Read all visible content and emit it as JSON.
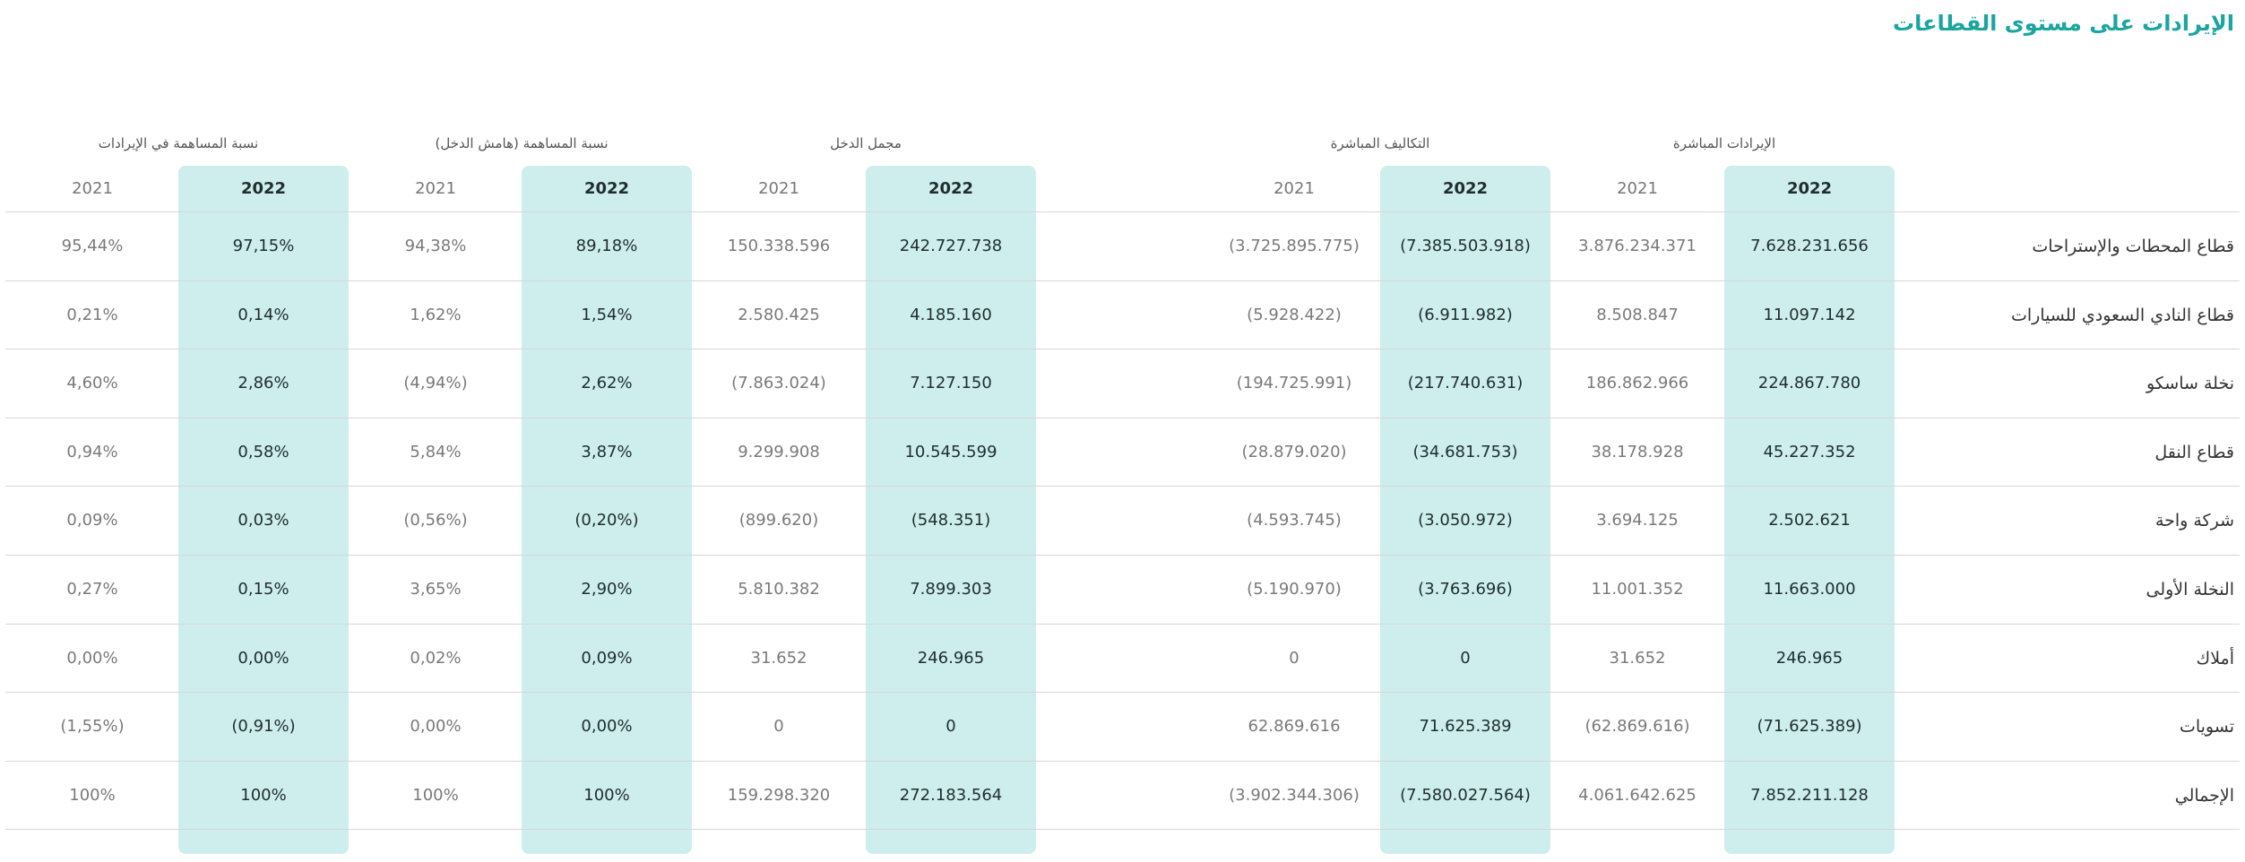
{
  "page_title": "الإيرادات على مستوى القطاعات",
  "group_headers": {
    "direct_revenues": "الإيرادات المباشرة",
    "direct_costs": "التكاليف المباشرة",
    "total_income": "مجمل الدخل",
    "contribution_margin": "نسبة المساهمة (هامش الدخل)",
    "contribution_revenue": "نسبة المساهمة في الإيرادات"
  },
  "years": {
    "current": "2022",
    "previous": "2021"
  },
  "columns": [
    "revenue_2022",
    "revenue_2021",
    "cost_2022",
    "cost_2021",
    "income_2022",
    "income_2021",
    "margin_2022",
    "margin_2021",
    "share_2022",
    "share_2021"
  ],
  "rows": [
    {
      "label": "قطاع المحطات والإستراحات",
      "revenue_2022": "7.628.231.656",
      "revenue_2021": "3.876.234.371",
      "cost_2022": "(7.385.503.918)",
      "cost_2021": "(3.725.895.775)",
      "income_2022": "242.727.738",
      "income_2021": "150.338.596",
      "margin_2022": "89,18%",
      "margin_2021": "94,38%",
      "share_2022": "97,15%",
      "share_2021": "95,44%"
    },
    {
      "label": "قطاع النادي السعودي للسيارات",
      "revenue_2022": "11.097.142",
      "revenue_2021": "8.508.847",
      "cost_2022": "(6.911.982)",
      "cost_2021": "(5.928.422)",
      "income_2022": "4.185.160",
      "income_2021": "2.580.425",
      "margin_2022": "1,54%",
      "margin_2021": "1,62%",
      "share_2022": "0,14%",
      "share_2021": "0,21%"
    },
    {
      "label": "نخلة ساسكو",
      "revenue_2022": "224.867.780",
      "revenue_2021": "186.862.966",
      "cost_2022": "(217.740.631)",
      "cost_2021": "(194.725.991)",
      "income_2022": "7.127.150",
      "income_2021": "(7.863.024)",
      "margin_2022": "2,62%",
      "margin_2021": "(4,94%)",
      "share_2022": "2,86%",
      "share_2021": "4,60%"
    },
    {
      "label": "قطاع النقل",
      "revenue_2022": "45.227.352",
      "revenue_2021": "38.178.928",
      "cost_2022": "(34.681.753)",
      "cost_2021": "(28.879.020)",
      "income_2022": "10.545.599",
      "income_2021": "9.299.908",
      "margin_2022": "3,87%",
      "margin_2021": "5,84%",
      "share_2022": "0,58%",
      "share_2021": "0,94%"
    },
    {
      "label": "شركة واحة",
      "revenue_2022": "2.502.621",
      "revenue_2021": "3.694.125",
      "cost_2022": "(3.050.972)",
      "cost_2021": "(4.593.745)",
      "income_2022": "(548.351)",
      "income_2021": "(899.620)",
      "margin_2022": "(0,20%)",
      "margin_2021": "(0,56%)",
      "share_2022": "0,03%",
      "share_2021": "0,09%"
    },
    {
      "label": "النخلة الأولى",
      "revenue_2022": "11.663.000",
      "revenue_2021": "11.001.352",
      "cost_2022": "(3.763.696)",
      "cost_2021": "(5.190.970)",
      "income_2022": "7.899.303",
      "income_2021": "5.810.382",
      "margin_2022": "2,90%",
      "margin_2021": "3,65%",
      "share_2022": "0,15%",
      "share_2021": "0,27%"
    },
    {
      "label": "أملاك",
      "revenue_2022": "246.965",
      "revenue_2021": "31.652",
      "cost_2022": "0",
      "cost_2021": "0",
      "income_2022": "246.965",
      "income_2021": "31.652",
      "margin_2022": "0,09%",
      "margin_2021": "0,02%",
      "share_2022": "0,00%",
      "share_2021": "0,00%"
    },
    {
      "label": "تسويات",
      "revenue_2022": "(71.625.389)",
      "revenue_2021": "(62.869.616)",
      "cost_2022": "71.625.389",
      "cost_2021": "62.869.616",
      "income_2022": "0",
      "income_2021": "0",
      "margin_2022": "0,00%",
      "margin_2021": "0,00%",
      "share_2022": "(0,91%)",
      "share_2021": "(1,55%)"
    },
    {
      "label": "الإجمالي",
      "revenue_2022": "7.852.211.128",
      "revenue_2021": "4.061.642.625",
      "cost_2022": "(7.580.027.564)",
      "cost_2021": "(3.902.344.306)",
      "income_2022": "272.183.564",
      "income_2021": "159.298.320",
      "margin_2022": "100%",
      "margin_2021": "100%",
      "share_2022": "100%",
      "share_2021": "100%"
    }
  ],
  "colors": {
    "title": "#1aa5a1",
    "highlight": "#cdeeed",
    "rule": "#d6d6d6"
  }
}
